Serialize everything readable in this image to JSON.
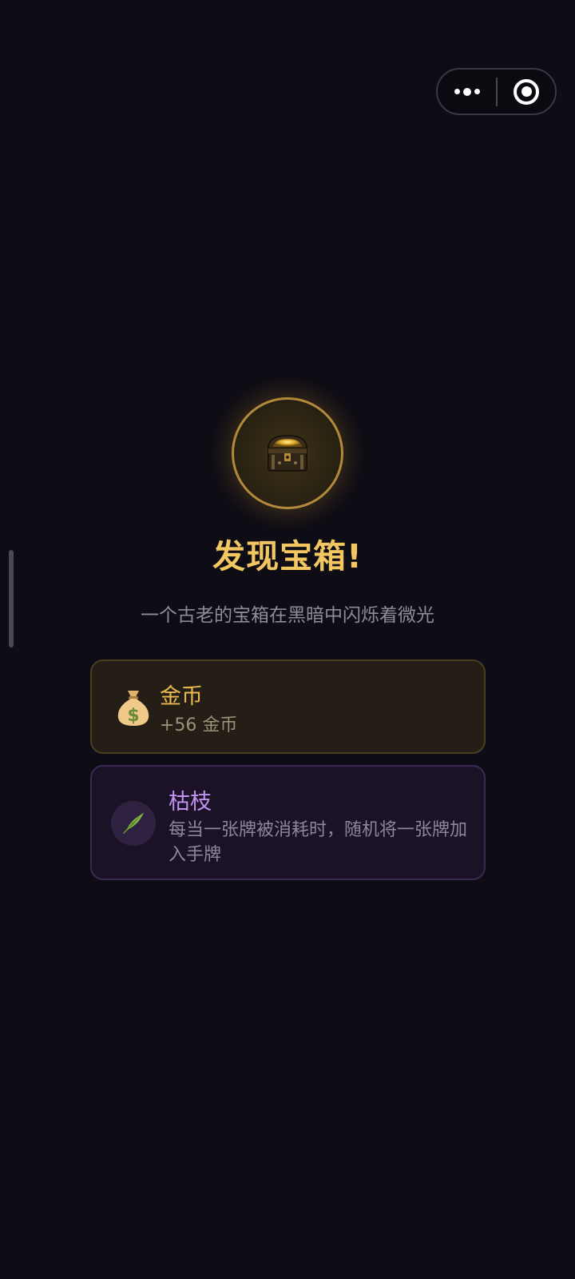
{
  "capsule": {
    "more_icon": "more-dots-icon",
    "close_icon": "target-circle-icon"
  },
  "event": {
    "icon": "treasure-chest-icon",
    "title": "发现宝箱!",
    "subtitle": "一个古老的宝箱在黑暗中闪烁着微光"
  },
  "rewards": [
    {
      "icon": "money-bag-icon",
      "name": "金币",
      "desc": "+56 金币",
      "color": "#e9b84f"
    },
    {
      "icon": "feather-twig-icon",
      "name": "枯枝",
      "desc": "每当一张牌被消耗时，随机将一张牌加入手牌",
      "color": "#c393f2"
    }
  ],
  "colors": {
    "background": "#0e0c15",
    "gold_accent": "#f2c660",
    "relic_accent": "#c393f2"
  }
}
